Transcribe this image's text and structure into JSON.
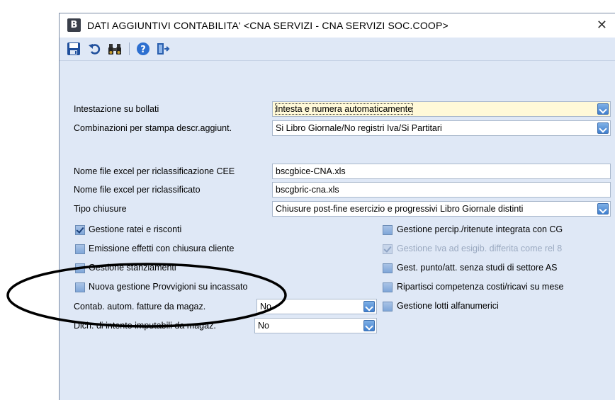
{
  "window": {
    "app_icon_letter": "B",
    "title": "DATI AGGIUNTIVI CONTABILITA' <CNA SERVIZI - CNA SERVIZI SOC.COOP>",
    "close_glyph": "✕"
  },
  "toolbar": {
    "icons": [
      "save-icon",
      "undo-icon",
      "binoculars-icon",
      "help-icon",
      "exit-icon"
    ]
  },
  "form": {
    "intestazione": {
      "label": "Intestazione su bollati",
      "value": "Intesta e numera automaticamente"
    },
    "combinazioni": {
      "label": "Combinazioni per stampa descr.aggiunt.",
      "value": "Si Libro Giornale/No registri Iva/Si Partitari"
    },
    "excel_cee": {
      "label": "Nome file excel per riclassificazione CEE",
      "value": "bscgbice-CNA.xls"
    },
    "excel_ricl": {
      "label": "Nome file excel per riclassificato",
      "value": "bscgbric-cna.xls"
    },
    "tipo_chiusure": {
      "label": "Tipo chiusure",
      "value": "Chiusure post-fine esercizio e progressivi Libro Giornale distinti"
    },
    "contab_autom": {
      "label": "Contab. autom. fatture da magaz.",
      "value": "No"
    },
    "dich_intento": {
      "label": "Dich. di intento imputabili da magaz.",
      "value": "No"
    }
  },
  "checkboxes_left": [
    {
      "label": "Gestione ratei e risconti",
      "checked": true
    },
    {
      "label": "Emissione effetti con chiusura cliente",
      "checked": false
    },
    {
      "label": "Gestione stanziamenti",
      "checked": false
    },
    {
      "label": "Nuova gestione Provvigioni su incassato",
      "checked": false
    }
  ],
  "checkboxes_right": [
    {
      "label": "Gestione percip./ritenute integrata con CG",
      "checked": false,
      "disabled": false
    },
    {
      "label": "Gestione Iva ad esigib. differita come rel 8",
      "checked": true,
      "disabled": true
    },
    {
      "label": "Gest. punto/att. senza studi di settore AS",
      "checked": false,
      "disabled": false
    },
    {
      "label": "Ripartisci competenza costi/ricavi su mese",
      "checked": false,
      "disabled": false
    },
    {
      "label": "Gestione lotti alfanumerici",
      "checked": false,
      "disabled": false
    }
  ],
  "colors": {
    "panel": "#dfe8f6",
    "highlight_field": "#fff9d8",
    "annotation": "#000000"
  }
}
